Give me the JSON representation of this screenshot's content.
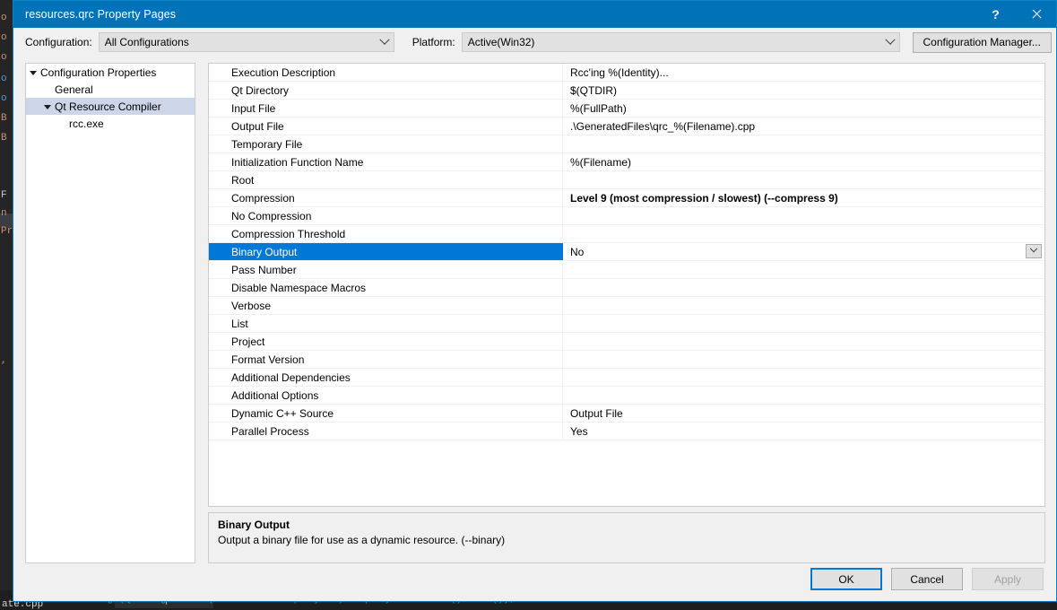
{
  "window": {
    "title": "resources.qrc Property Pages",
    "help_glyph": "?",
    "close_glyph": "✕"
  },
  "config_bar": {
    "configuration_label": "Configuration:",
    "configuration_value": "All Configurations",
    "platform_label": "Platform:",
    "platform_value": "Active(Win32)",
    "configuration_manager_label": "Configuration Manager..."
  },
  "tree": {
    "items": [
      {
        "label": "Configuration Properties",
        "level": 0,
        "expandable": true,
        "selected": false
      },
      {
        "label": "General",
        "level": 1,
        "expandable": false,
        "selected": false
      },
      {
        "label": "Qt Resource Compiler",
        "level": 1,
        "expandable": true,
        "selected": true
      },
      {
        "label": "rcc.exe",
        "level": 2,
        "expandable": false,
        "selected": false
      }
    ]
  },
  "grid": {
    "rows": [
      {
        "name": "Execution Description",
        "value": "Rcc'ing %(Identity)...",
        "bold": false,
        "selected": false
      },
      {
        "name": "Qt Directory",
        "value": "$(QTDIR)",
        "bold": false,
        "selected": false
      },
      {
        "name": "Input File",
        "value": "%(FullPath)",
        "bold": false,
        "selected": false
      },
      {
        "name": "Output File",
        "value": ".\\GeneratedFiles\\qrc_%(Filename).cpp",
        "bold": false,
        "selected": false
      },
      {
        "name": "Temporary File",
        "value": "",
        "bold": false,
        "selected": false
      },
      {
        "name": "Initialization Function Name",
        "value": "%(Filename)",
        "bold": false,
        "selected": false
      },
      {
        "name": "Root",
        "value": "",
        "bold": false,
        "selected": false
      },
      {
        "name": "Compression",
        "value": "Level 9 (most compression / slowest) (--compress 9)",
        "bold": true,
        "selected": false
      },
      {
        "name": "No Compression",
        "value": "",
        "bold": false,
        "selected": false
      },
      {
        "name": "Compression Threshold",
        "value": "",
        "bold": false,
        "selected": false
      },
      {
        "name": "Binary Output",
        "value": "No",
        "bold": false,
        "selected": true
      },
      {
        "name": "Pass Number",
        "value": "",
        "bold": false,
        "selected": false
      },
      {
        "name": "Disable Namespace Macros",
        "value": "",
        "bold": false,
        "selected": false
      },
      {
        "name": "Verbose",
        "value": "",
        "bold": false,
        "selected": false
      },
      {
        "name": "List",
        "value": "",
        "bold": false,
        "selected": false
      },
      {
        "name": "Project",
        "value": "",
        "bold": false,
        "selected": false
      },
      {
        "name": "Format Version",
        "value": "",
        "bold": false,
        "selected": false
      },
      {
        "name": "Additional Dependencies",
        "value": "",
        "bold": false,
        "selected": false
      },
      {
        "name": "Additional Options",
        "value": "",
        "bold": false,
        "selected": false
      },
      {
        "name": "Dynamic C++ Source",
        "value": "Output File",
        "bold": false,
        "selected": false
      },
      {
        "name": "Parallel Process",
        "value": "Yes",
        "bold": false,
        "selected": false
      }
    ]
  },
  "description": {
    "title": "Binary Output",
    "text": "Output a binary file for use as a dynamic resource. (--binary)"
  },
  "footer": {
    "ok_label": "OK",
    "cancel_label": "Cancel",
    "apply_label": "Apply"
  },
  "background": {
    "left_fragments": [
      "o",
      "o",
      "B",
      "B",
      "F",
      "n",
      "Pr"
    ],
    "bottom_file_label": "ate.cpp",
    "bottom_code": "rrorMessage(QStringLiteral(\"Cannot send query: \") + query.lastError().text());"
  },
  "colors": {
    "titlebar": "#0072b8",
    "selection": "#0078d7",
    "tree_selection": "#cdd5e8",
    "dialog_bg": "#f0f0f0",
    "editor_bg": "#1e1e1e"
  }
}
